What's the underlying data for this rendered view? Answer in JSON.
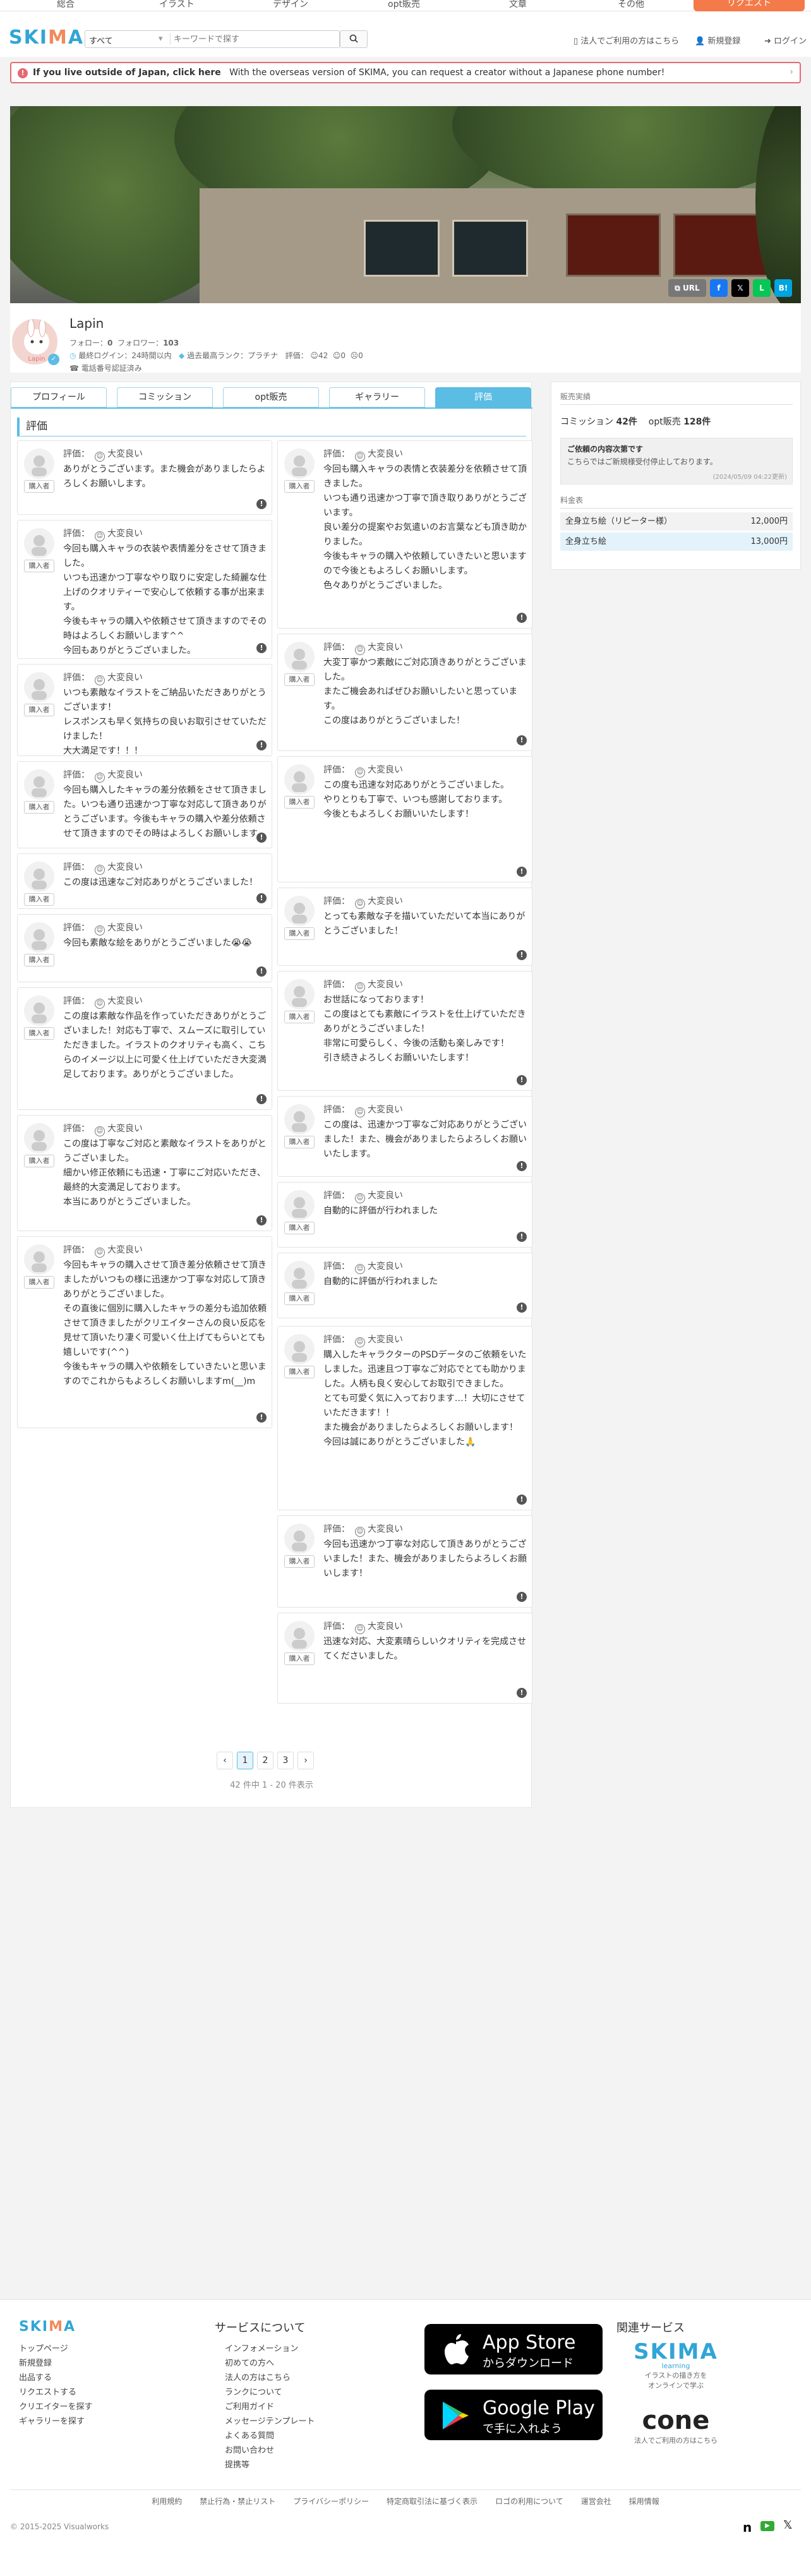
{
  "topnav": {
    "items": [
      "総合",
      "イラスト",
      "デザイン",
      "opt販売",
      "文章",
      "その他"
    ],
    "request": "リクエスト"
  },
  "header": {
    "logo": "SKIMA",
    "search_category": "すべて",
    "search_placeholder": "キーワードで探す",
    "corp_link": "法人でご利用の方はこちら",
    "register": "新規登録",
    "login": "ログイン"
  },
  "intl": {
    "bold": "If you live outside of Japan, click here",
    "text": "With the overseas version of SKIMA, you can request a creator without a Japanese phone number!"
  },
  "shares": {
    "url": "URL"
  },
  "profile": {
    "name": "Lapin",
    "follow_label": "フォロー",
    "follow": "0",
    "follower_label": "フォロワー",
    "follower": "103",
    "last_login": "最終ログイン：24時間以内",
    "rank": "過去最高ランク：プラチナ",
    "review_label": "評価",
    "good": "42",
    "normal": "0",
    "bad": "0",
    "phone": "電話番号認証済み"
  },
  "tabs": [
    "プロフィール",
    "コミッション",
    "opt販売",
    "ギャラリー",
    "評価"
  ],
  "section_title": "評価",
  "rating_label": "評価：",
  "rating_value": "大変良い",
  "buyer_badge": "購入者",
  "reviews_left": [
    "ありがとうございます。また機会がありましたらよろしくお願いします。",
    "今回も購入キャラの衣装や表情差分をさせて頂きました。\nいつも迅速かつ丁寧なやり取りに安定した綺麗な仕上げのクオリティーで安心して依頼する事が出来ます。\n今後もキャラの購入や依頼させて頂きますのでその時はよろしくお願いします^^\n今回もありがとうございました。",
    "いつも素敵なイラストをご納品いただきありがとうございます！\nレスポンスも早く気持ちの良いお取引させていただけました！\n大大満足です！！！",
    "今回も購入したキャラの差分依頼をさせて頂きました。いつも通り迅速かつ丁寧な対応して頂きありがとうございます。今後もキャラの購入や差分依頼させて頂きますのでその時はよろしくお願いします。",
    "この度は迅速なご対応ありがとうございました！",
    "今回も素敵な絵をありがとうございました😭😭",
    "この度は素敵な作品を作っていただきありがとうございました！対応も丁寧で、スムーズに取引していただきました。イラストのクオリティも高く、こちらのイメージ以上に可愛く仕上げていただき大変満足しております。ありがとうございました。",
    "この度は丁寧なご対応と素敵なイラストをありがとうございました。\n細かい修正依頼にも迅速・丁寧にご対応いただき、最終的大変満足しております。\n本当にありがとうございました。",
    "今回もキャラの購入させて頂き差分依頼させて頂きましたがいつもの様に迅速かつ丁寧な対応して頂きありがとうございました。\nその直後に個別に購入したキャラの差分も追加依頼させて頂きましたがクリエイターさんの良い反応を見せて頂いたり凄く可愛いく仕上げてもらいとても嬉しいです(^^)\n今後もキャラの購入や依頼をしていきたいと思いますのでこれからもよろしくお願いしますm(__)m"
  ],
  "reviews_right": [
    "今回も購入キャラの表情と衣装差分を依頼させて頂きました。\nいつも通り迅速かつ丁寧で頂き取りありがとうございます。\n良い差分の提案やお気遣いのお言葉なども頂き助かりました。\n今後もキャラの購入や依頼していきたいと思いますので今後ともよろしくお願いします。\n色々ありがとうございました。",
    "大変丁寧かつ素敵にご対応頂きありがとうございました。\nまたご機会あればぜひお願いしたいと思っています。\nこの度はありがとうございました！",
    "この度も迅速な対応ありがとうございました。\nやりとりも丁寧で、いつも感謝しております。\n今後ともよろしくお願いいたします！",
    "とっても素敵な子を描いていただいて本当にありがとうございました！",
    "お世話になっております！\nこの度はとても素敵にイラストを仕上げていただきありがとうございました！\n非常に可愛らしく、今後の活動も楽しみです！\n引き続きよろしくお願いいたします！",
    "この度は、迅速かつ丁寧なご対応ありがとうございました！また、機会がありましたらよろしくお願いいたします。",
    "自動的に評価が行われました",
    "自動的に評価が行われました",
    "購入したキャラクターのPSDデータのご依頼をいたしました。迅速且つ丁寧なご対応でとても助かりました。人柄も良く安心してお取引できました。\nとても可愛く気に入っております…！大切にさせていただきます！！\nまた機会がありましたらよろしくお願いします！\n今回は誠にありがとうございました🙏",
    "今回も迅速かつ丁寧な対応して頂きありがとうございました！また、機会がありましたらよろしくお願いします！",
    "迅速な対応、大変素晴らしいクオリティを完成させてくださいました。"
  ],
  "pager": {
    "prev": "‹",
    "pages": [
      "1",
      "2",
      "3"
    ],
    "next": "›",
    "count": "42 件中 1 - 20 件表示"
  },
  "sidebar": {
    "sales_label": "販売実績",
    "commission_label": "コミッション",
    "commission": "42件",
    "opt_label": "opt販売",
    "opt": "128件",
    "notice_title": "ご依頼の内容次第です",
    "notice_body": "こちらではご新規様受付停止しております。",
    "notice_date": "(2024/05/09 04:22更新)",
    "price_label": "料金表",
    "prices": [
      {
        "name": "全身立ち絵（リピーター様）",
        "value": "12,000円"
      },
      {
        "name": "全身立ち絵",
        "value": "13,000円"
      }
    ]
  },
  "footer": {
    "logo": "SKIMA",
    "links1": [
      "トップページ",
      "新規登録",
      "出品する",
      "リクエストする",
      "クリエイターを探す",
      "ギャラリーを探す"
    ],
    "service_title": "サービスについて",
    "links2": [
      "インフォメーション",
      "初めての方へ",
      "法人の方はこちら",
      "ランクについて",
      "ご利用ガイド",
      "メッセージテンプレート",
      "よくある質問",
      "お問い合わせ",
      "提携等"
    ],
    "appstore_big": "App Store",
    "appstore_small": "からダウンロード",
    "googleplay_big": "Google Play",
    "googleplay_small": "で手に入れよう",
    "related_title": "関連サービス",
    "learning_name": "SKIMA",
    "learning_sub": "learning",
    "learning_desc1": "イラストの描き方を",
    "learning_desc2": "オンラインで学ぶ",
    "cone_name": "cone",
    "cone_desc": "法人でご利用の方はこちら",
    "bottom_links": [
      "利用規約",
      "禁止行為・禁止リスト",
      "プライバシーポリシー",
      "特定商取引法に基づく表示",
      "ロゴの利用について",
      "運営会社",
      "採用情報"
    ],
    "copyright": "© 2015-2025 Visualworks"
  }
}
